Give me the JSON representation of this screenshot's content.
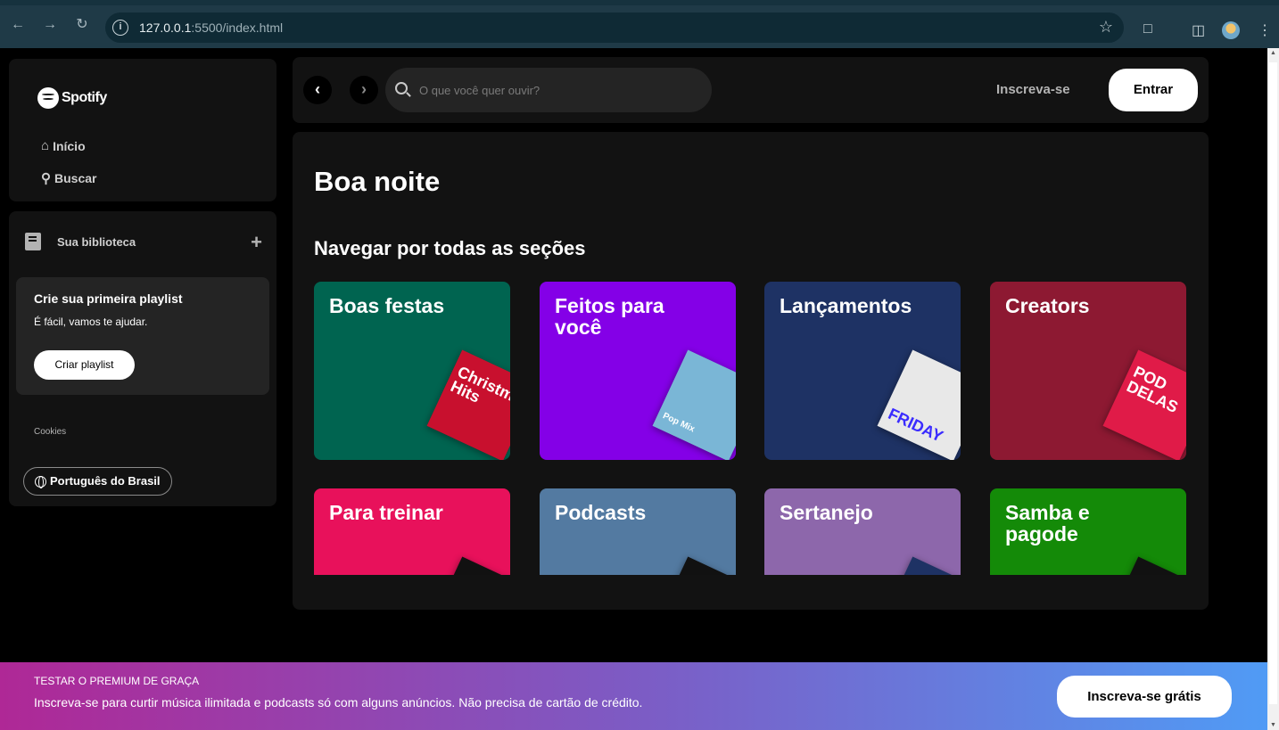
{
  "browser": {
    "url_host": "127.0.0.1",
    "url_rest": ":5500/index.html",
    "back_icon": "arrow-left-icon",
    "forward_icon": "arrow-right-icon",
    "reload_icon": "reload-icon"
  },
  "sidebar": {
    "brand": "Spotify",
    "nav": [
      {
        "label": "Início",
        "icon": "home-icon"
      },
      {
        "label": "Buscar",
        "icon": "search-icon"
      }
    ],
    "library": {
      "title": "Sua biblioteca",
      "playlist_card": {
        "title": "Crie sua primeira playlist",
        "subtitle": "É fácil, vamos te ajudar.",
        "button": "Criar playlist"
      },
      "cookies": "Cookies",
      "language": "Português do Brasil"
    }
  },
  "header": {
    "search_placeholder": "O que você quer ouvir?",
    "signup": "Inscreva-se",
    "login": "Entrar"
  },
  "main": {
    "greeting": "Boa noite",
    "section_title": "Navegar por todas as seções",
    "tiles": [
      {
        "label": "Boas festas",
        "color": "#006450",
        "art_text": "Christmas Hits",
        "art_color": "#c8102e"
      },
      {
        "label": "Feitos para você",
        "color": "#8400e7",
        "art_text": "Pop Mix",
        "art_color": "#7ab6d6"
      },
      {
        "label": "Lançamentos",
        "color": "#1e3264",
        "art_text": "FRIDAY",
        "art_color": "#e8e8e8"
      },
      {
        "label": "Creators",
        "color": "#8d1932",
        "art_text": "POD DELAS",
        "art_color": "#e01b48"
      },
      {
        "label": "Para treinar",
        "color": "#e8115b",
        "art_text": "",
        "art_color": "#111111"
      },
      {
        "label": "Podcasts",
        "color": "#537aa1",
        "art_text": "",
        "art_color": "#111111"
      },
      {
        "label": "Sertanejo",
        "color": "#8d67ab",
        "art_text": "",
        "art_color": "#1e3264"
      },
      {
        "label": "Samba e pagode",
        "color": "#148a08",
        "art_text": "",
        "art_color": "#111111"
      }
    ]
  },
  "banner": {
    "title": "TESTAR O PREMIUM DE GRAÇA",
    "text": "Inscreva-se para curtir música ilimitada e podcasts só com alguns anúncios. Não precisa de cartão de crédito.",
    "button": "Inscreva-se grátis"
  }
}
